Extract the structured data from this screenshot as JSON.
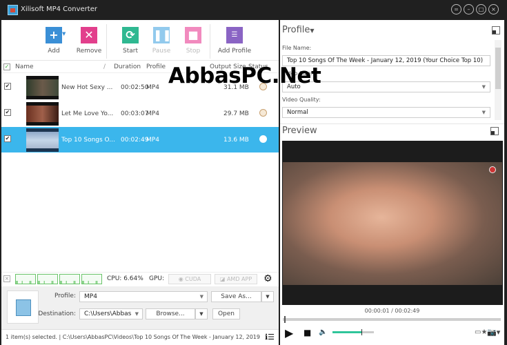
{
  "window": {
    "title": "Xilisoft MP4 Converter",
    "controls": [
      "menu",
      "minimize",
      "maximize",
      "close"
    ]
  },
  "toolbar": {
    "add": "Add",
    "remove": "Remove",
    "start": "Start",
    "pause": "Pause",
    "stop": "Stop",
    "add_profile": "Add Profile"
  },
  "colors": {
    "add": "#3a8fd6",
    "remove": "#e23f8c",
    "start": "#2fb891",
    "pause": "#3aa0e0",
    "stop": "#e83d93",
    "add_profile": "#8a64c4",
    "selection": "#3bb6ec",
    "volume": "#2fc59a"
  },
  "list": {
    "columns": {
      "name": "Name",
      "duration": "Duration",
      "profile": "Profile",
      "output_size": "Output Size",
      "status": "Status"
    },
    "rows": [
      {
        "name": "New Hot Sexy ...",
        "duration": "00:02:50",
        "profile": "MP4",
        "size": "31.1 MB",
        "checked": true,
        "selected": false
      },
      {
        "name": "Let Me Love Yo...",
        "duration": "00:03:07",
        "profile": "MP4",
        "size": "29.7 MB",
        "checked": true,
        "selected": false
      },
      {
        "name": "Top 10 Songs O...",
        "duration": "00:02:49",
        "profile": "MP4",
        "size": "13.6 MB",
        "checked": true,
        "selected": true
      }
    ]
  },
  "cpu": {
    "label": "CPU: 6.64%",
    "gpu_label": "GPU:",
    "cuda": "CUDA",
    "amd": "AMD APP"
  },
  "output": {
    "profile_label": "Profile:",
    "profile_value": "MP4",
    "save_as": "Save As...",
    "destination_label": "Destination:",
    "destination_value": "C:\\Users\\Abbas",
    "browse": "Browse...",
    "open": "Open",
    "format_icon": "MP4"
  },
  "status_bar": {
    "text": "1 item(s) selected. | C:\\Users\\AbbasPC\\Videos\\Top 10 Songs Of The Week - January 12, 2019 ("
  },
  "profile_panel": {
    "title": "Profile",
    "file_name_label": "File Name:",
    "file_name_value": "Top 10 Songs Of The Week - January 12, 2019 (Your Choice Top 10)",
    "video_size_label": "Video Size:",
    "video_size_value": "Auto",
    "video_quality_label": "Video Quality:",
    "video_quality_value": "Normal"
  },
  "preview": {
    "title": "Preview",
    "time": "00:00:01 / 00:02:49",
    "seek_fraction": 0.006,
    "volume_fraction": 0.7
  },
  "watermark": "AbbasPC.Net"
}
